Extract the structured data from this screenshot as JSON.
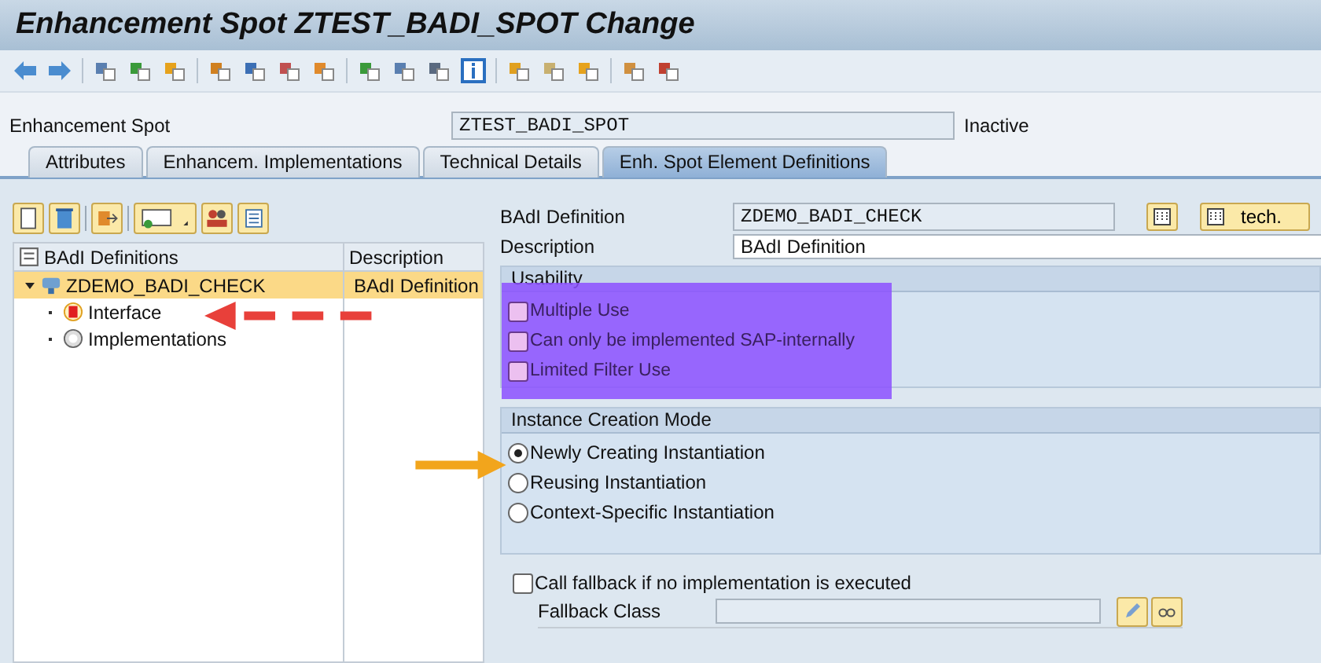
{
  "window": {
    "title": "Enhancement Spot ZTEST_BADI_SPOT Change"
  },
  "header": {
    "label": "Enhancement Spot",
    "value": "ZTEST_BADI_SPOT",
    "status": "Inactive"
  },
  "tabs": [
    {
      "label": "Attributes",
      "selected": false
    },
    {
      "label": "Enhancem. Implementations",
      "selected": false
    },
    {
      "label": "Technical Details",
      "selected": false
    },
    {
      "label": "Enh. Spot Element Definitions",
      "selected": true
    }
  ],
  "tree": {
    "columns": [
      "BAdI Definitions",
      "Description"
    ],
    "rows": [
      {
        "label": "ZDEMO_BADI_CHECK",
        "description": "BAdI  Definition",
        "kind": "definition",
        "expanded": true,
        "selected": true,
        "children": [
          {
            "label": "Interface",
            "kind": "interface",
            "selected": false
          },
          {
            "label": "Implementations",
            "kind": "implementations",
            "selected": false
          }
        ]
      }
    ]
  },
  "definition": {
    "name_label": "BAdI Definition",
    "name_value": "ZDEMO_BADI_CHECK",
    "tech_button": "tech.",
    "description_label": "Description",
    "description_value": "BAdI  Definition"
  },
  "usability": {
    "title": "Usability",
    "options": [
      {
        "label": "Multiple Use",
        "checked": false
      },
      {
        "label": "Can only be implemented SAP-internally",
        "checked": false
      },
      {
        "label": "Limited Filter Use",
        "checked": false
      }
    ]
  },
  "instance_creation": {
    "title": "Instance Creation Mode",
    "options": [
      {
        "label": "Newly Creating Instantiation",
        "selected": true
      },
      {
        "label": "Reusing Instantiation",
        "selected": false
      },
      {
        "label": "Context-Specific Instantiation",
        "selected": false
      }
    ]
  },
  "fallback": {
    "label": "Call fallback if no implementation is executed",
    "checked": false,
    "class_label": "Fallback Class"
  }
}
